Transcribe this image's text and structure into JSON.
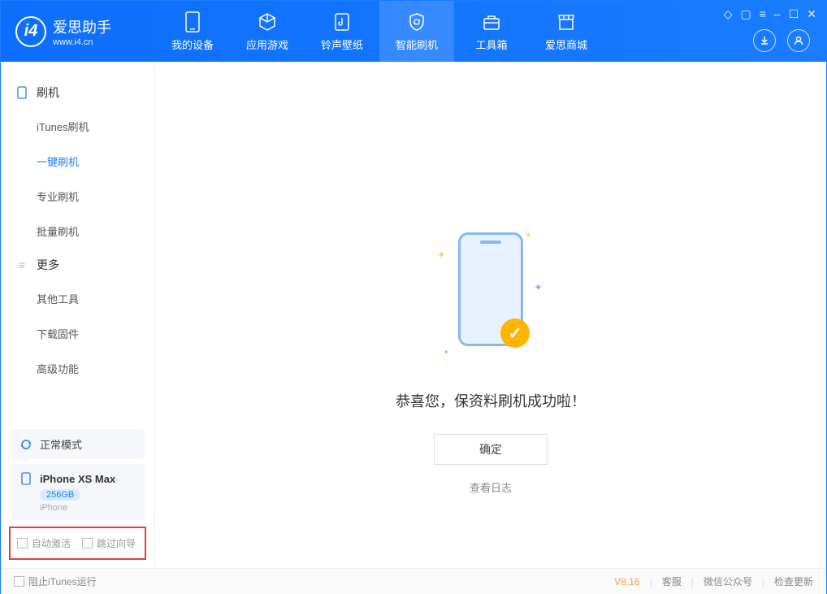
{
  "app": {
    "title": "爱思助手",
    "subtitle": "www.i4.cn"
  },
  "nav": {
    "tabs": [
      {
        "label": "我的设备"
      },
      {
        "label": "应用游戏"
      },
      {
        "label": "铃声壁纸"
      },
      {
        "label": "智能刷机"
      },
      {
        "label": "工具箱"
      },
      {
        "label": "爱思商城"
      }
    ]
  },
  "sidebar": {
    "section1": {
      "title": "刷机",
      "items": [
        {
          "label": "iTunes刷机"
        },
        {
          "label": "一键刷机"
        },
        {
          "label": "专业刷机"
        },
        {
          "label": "批量刷机"
        }
      ]
    },
    "section2": {
      "title": "更多",
      "items": [
        {
          "label": "其他工具"
        },
        {
          "label": "下载固件"
        },
        {
          "label": "高级功能"
        }
      ]
    },
    "mode_label": "正常模式",
    "device": {
      "name": "iPhone XS Max",
      "storage": "256GB",
      "type": "iPhone"
    },
    "checks": {
      "auto_activate": "自动激活",
      "skip_guide": "跳过向导"
    }
  },
  "main": {
    "success_text": "恭喜您，保资料刷机成功啦！",
    "ok_button": "确定",
    "view_log": "查看日志"
  },
  "footer": {
    "block_itunes": "阻止iTunes运行",
    "version": "V8.16",
    "support": "客服",
    "wechat": "微信公众号",
    "check_update": "检查更新"
  }
}
